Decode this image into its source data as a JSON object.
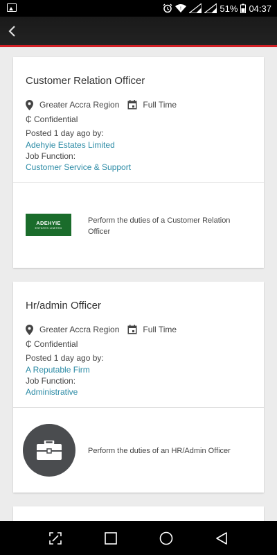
{
  "status_bar": {
    "battery": "51%",
    "time": "04:37"
  },
  "jobs": [
    {
      "title": "Customer Relation Officer",
      "location": "Greater Accra Region",
      "type": "Full Time",
      "salary": "₵ Confidential",
      "posted": "Posted 1 day ago by:",
      "company": "Adehyie Estates Limited",
      "function_label": "Job Function:",
      "function": "Customer Service & Support",
      "description": "Perform the duties of a Customer Relation Officer",
      "logo_name": "ADEHYIE",
      "logo_sub": "ESTATES LIMITED"
    },
    {
      "title": "Hr/admin Officer",
      "location": "Greater Accra Region",
      "type": "Full Time",
      "salary": "₵ Confidential",
      "posted": "Posted 1 day ago by:",
      "company": "A Reputable Firm",
      "function_label": "Job Function:",
      "function": "Administrative",
      "description": "Perform the duties of an HR/Admin Officer"
    }
  ],
  "colors": {
    "accent_red": "#d32026",
    "link": "#2a8aa5",
    "logo_green": "#1a6c2b"
  },
  "icons": {
    "back": "chevron-left-icon",
    "location": "location-pin-icon",
    "type": "calendar-icon",
    "fallback_logo": "briefcase-icon",
    "nav": [
      "screen-cast-icon",
      "square-icon",
      "circle-icon",
      "triangle-back-icon"
    ]
  }
}
